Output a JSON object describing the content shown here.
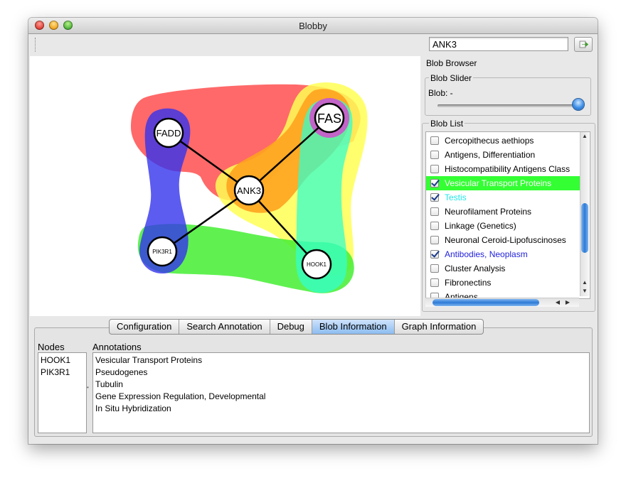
{
  "window": {
    "title": "Blobby"
  },
  "search": {
    "value": "ANK3"
  },
  "graph": {
    "nodes": [
      "FADD",
      "FAS",
      "ANK3",
      "PIK3R1",
      "HOOK1"
    ]
  },
  "blob_browser": {
    "title": "Blob Browser",
    "slider_title": "Blob Slider",
    "slider_label": "Blob: -",
    "list_title": "Blob List",
    "items": [
      {
        "label": "Cercopithecus aethiops",
        "checked": false
      },
      {
        "label": "Antigens, Differentiation",
        "checked": false
      },
      {
        "label": "Histocompatibility Antigens Class",
        "checked": false
      },
      {
        "label": "Vesicular Transport Proteins",
        "checked": true,
        "color": "#33ff33"
      },
      {
        "label": "Testis",
        "checked": true,
        "color": "#22e6e6"
      },
      {
        "label": "Neurofilament Proteins",
        "checked": false
      },
      {
        "label": "Linkage (Genetics)",
        "checked": false
      },
      {
        "label": "Neuronal Ceroid-Lipofuscinoses",
        "checked": false
      },
      {
        "label": "Antibodies, Neoplasm",
        "checked": true,
        "color": "#2222dd"
      },
      {
        "label": "Cluster Analysis",
        "checked": false
      },
      {
        "label": "Fibronectins",
        "checked": false
      },
      {
        "label": "Antigens",
        "checked": false
      }
    ]
  },
  "tabs": [
    "Configuration",
    "Search Annotation",
    "Debug",
    "Blob Information",
    "Graph Information"
  ],
  "active_tab": "Blob Information",
  "blob_info": {
    "nodes_header": "Nodes",
    "annotations_header": "Annotations",
    "nodes": [
      "HOOK1",
      "PIK3R1"
    ],
    "annotations": [
      "Vesicular Transport Proteins",
      "Pseudogenes",
      "Tubulin",
      "Gene Expression Regulation, Developmental",
      "In Situ Hybridization"
    ]
  }
}
